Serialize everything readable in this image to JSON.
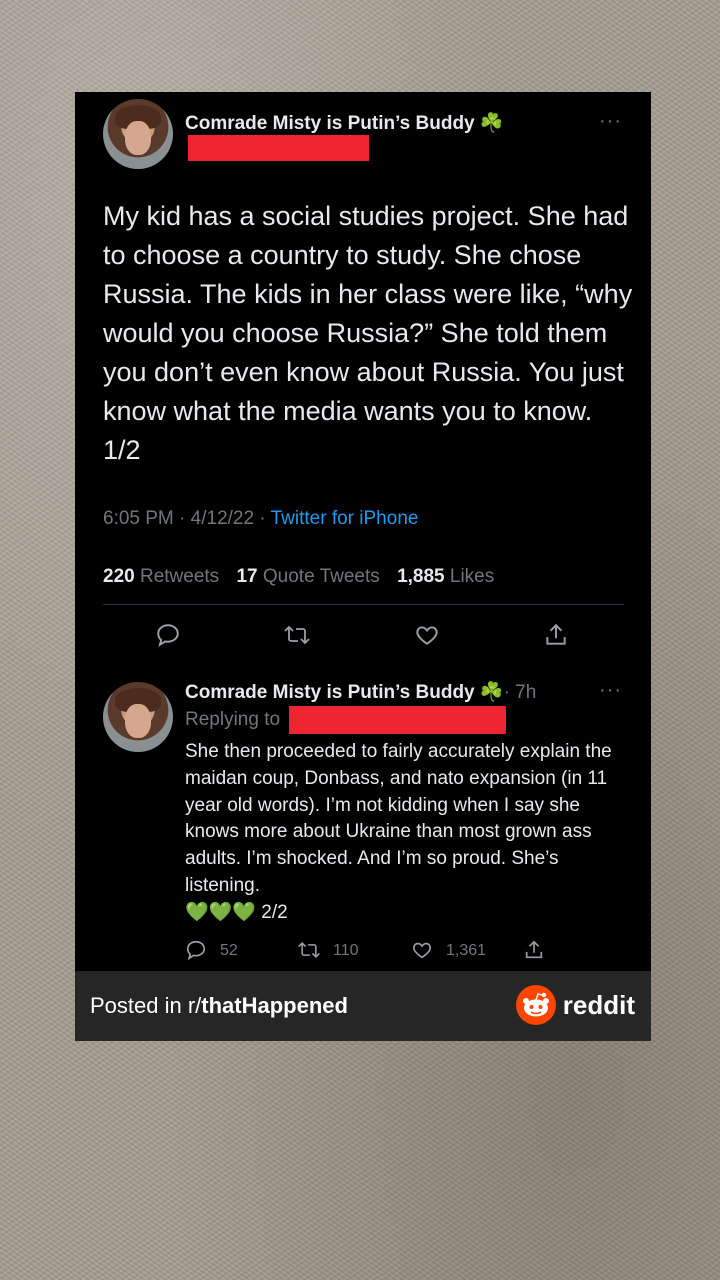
{
  "tweet": {
    "author": "Comrade Misty is Putin’s Buddy",
    "author_emoji": "☘️",
    "text": "My kid has a social studies project. She had to choose a country to study. She chose Russia. The kids in her class were like, “why would you choose Russia?” She told them you don’t even know about Russia. You just know what the media wants you to know. 1/2",
    "time": "6:05 PM",
    "date": "4/12/22",
    "source": "Twitter for iPhone",
    "retweets": "220",
    "retweets_label": "Retweets",
    "quotes": "17",
    "quotes_label": "Quote Tweets",
    "likes": "1,885",
    "likes_label": "Likes"
  },
  "reply": {
    "author": "Comrade Misty is Putin’s Buddy",
    "author_emoji": "☘️",
    "age": "· 7h",
    "replying_to": "Replying to",
    "text": "She then proceeded to fairly accurately explain the maidan coup, Donbass, and nato expansion (in 11 year old words). I’m not kidding when I say she knows more about Ukraine than most grown ass adults. I’m shocked. And I’m so proud. She’s listening.",
    "hearts": "💚💚💚",
    "thread_pos": "2/2",
    "replies_count": "52",
    "retweets_count": "110",
    "likes_count": "1,361"
  },
  "footer": {
    "posted_in": "Posted in ",
    "subreddit_prefix": "r/",
    "subreddit": "thatHappened",
    "brand": "reddit"
  },
  "icons": [
    "more-icon",
    "reply-icon",
    "retweet-icon",
    "like-icon",
    "share-icon",
    "reddit-logo-icon"
  ],
  "colors": {
    "accent_link": "#1d9bf0",
    "redaction": "#ee2431",
    "reddit": "#ff4500"
  }
}
